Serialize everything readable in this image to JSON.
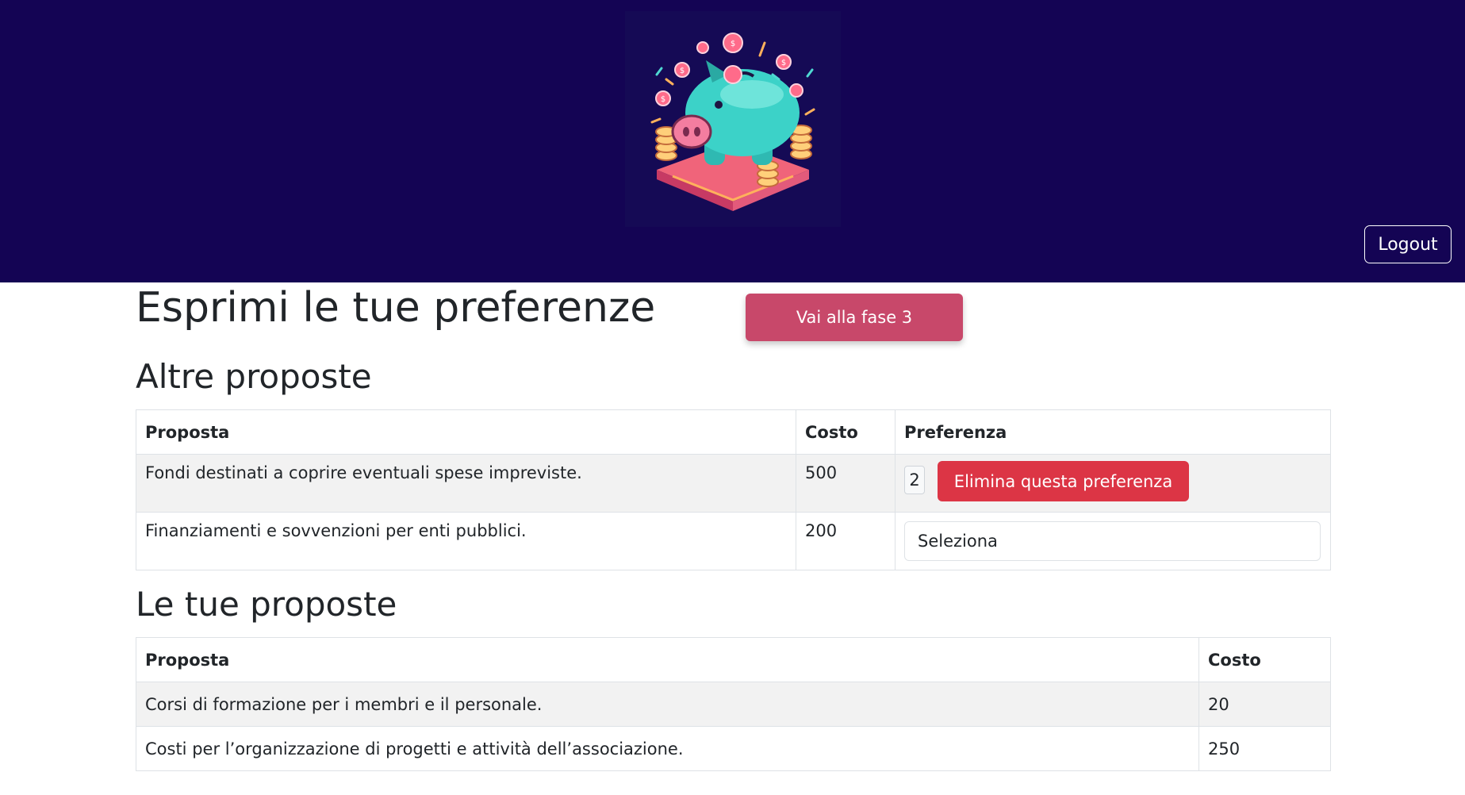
{
  "header": {
    "logo_alt": "piggy-bank-logo",
    "logout_label": "Logout"
  },
  "page": {
    "title": "Esprimi le tue preferenze",
    "phase_button": "Vai alla fase 3"
  },
  "other_proposals": {
    "title": "Altre proposte",
    "headers": [
      "Proposta",
      "Costo",
      "Preferenza"
    ],
    "rows": [
      {
        "proposta": "Fondi destinati a coprire eventuali spese impreviste.",
        "costo": "500",
        "preferenza_value": "2",
        "delete_label": "Elimina questa preferenza"
      },
      {
        "proposta": "Finanziamenti e sovvenzioni per enti pubblici.",
        "costo": "200",
        "select_value": "Seleziona"
      }
    ]
  },
  "my_proposals": {
    "title": "Le tue proposte",
    "headers": [
      "Proposta",
      "Costo"
    ],
    "rows": [
      {
        "proposta": "Corsi di formazione per i membri e il personale.",
        "costo": "20"
      },
      {
        "proposta": "Costi per l’organizzazione di progetti e attività dell’associazione.",
        "costo": "250"
      }
    ]
  },
  "colors": {
    "header_bg": "#140454",
    "phase_button": "#c8486a",
    "delete_button": "#dc3545"
  }
}
